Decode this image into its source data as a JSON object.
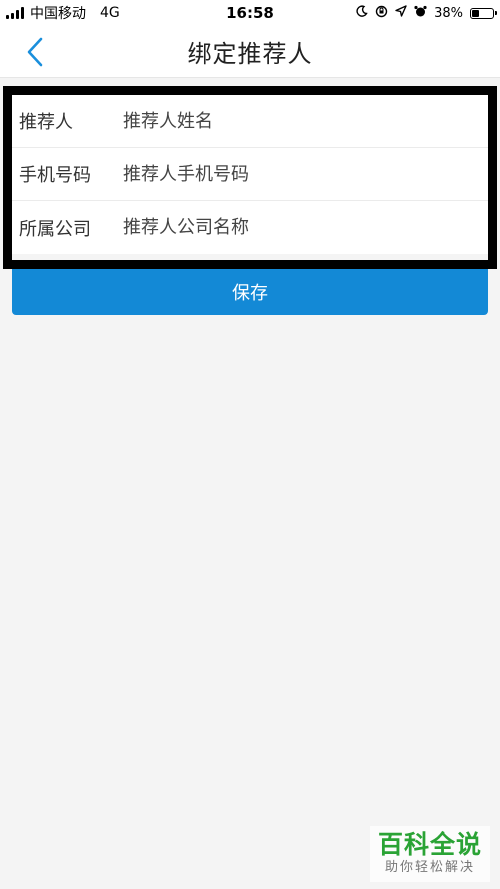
{
  "status_bar": {
    "carrier": "中国移动",
    "network": "4G",
    "time": "16:58",
    "battery_percent": "38%",
    "battery_level": 0.38
  },
  "nav": {
    "title": "绑定推荐人"
  },
  "form": {
    "rows": [
      {
        "label": "推荐人",
        "placeholder": "推荐人姓名",
        "value": ""
      },
      {
        "label": "手机号码",
        "placeholder": "推荐人手机号码",
        "value": ""
      },
      {
        "label": "所属公司",
        "placeholder": "推荐人公司名称",
        "value": ""
      }
    ]
  },
  "save_button": {
    "label": "保存",
    "color": "#1389d6"
  },
  "watermark": {
    "title": "百科全说",
    "subtitle": "助你轻松解决"
  },
  "colors": {
    "accent": "#1389d6",
    "watermark_green": "#2aa335",
    "highlight_border": "#000000"
  }
}
